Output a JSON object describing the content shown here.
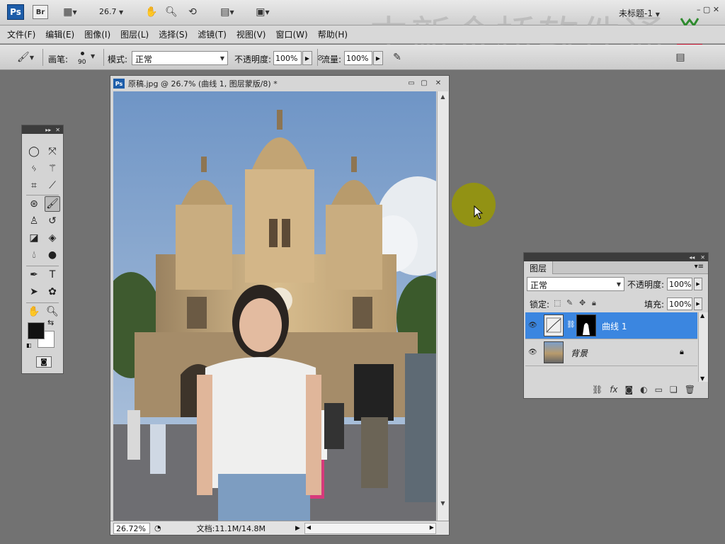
{
  "app": {
    "ps_logo": "Ps",
    "br_logo": "Br",
    "zoom": "26.7",
    "doc_title": "未标题-1"
  },
  "watermark": "中新金桥软件通",
  "menu": [
    "文件(F)",
    "编辑(E)",
    "图像(I)",
    "图层(L)",
    "选择(S)",
    "滤镜(T)",
    "视图(V)",
    "窗口(W)",
    "帮助(H)"
  ],
  "options": {
    "brush_label": "画笔:",
    "brush_size": "90",
    "mode_label": "模式:",
    "mode_value": "正常",
    "opacity_label": "不透明度:",
    "opacity_value": "100%",
    "flow_label": "流量:",
    "flow_value": "100%"
  },
  "document": {
    "title": "原稿.jpg @ 26.7% (曲线 1, 图层蒙版/8) *",
    "zoom_status": "26.72%",
    "doc_info": "文档:11.1M/14.8M"
  },
  "layers_panel": {
    "tab": "图层",
    "blend_mode": "正常",
    "opacity_label": "不透明度:",
    "opacity_value": "100%",
    "lock_label": "锁定:",
    "fill_label": "填充:",
    "fill_value": "100%",
    "layers": [
      {
        "name": "曲线 1",
        "selected": true
      },
      {
        "name": "背景",
        "selected": false
      }
    ]
  },
  "colors": {
    "selection_blue": "#3b86e0",
    "ps_blue": "#1d5da9",
    "workspace": "#727272"
  }
}
